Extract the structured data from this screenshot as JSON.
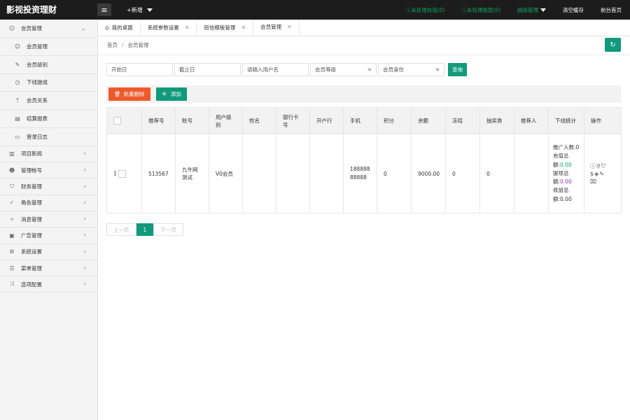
{
  "app": {
    "title": "影视投资理财",
    "menu_icon": "menu-icon",
    "new_label": "+新增"
  },
  "topbar": {
    "links": [
      {
        "label": "未处理充值(0)",
        "icon": "info-icon",
        "color": "#0aa65a"
      },
      {
        "label": "未处理提款(0)",
        "icon": "info-icon",
        "color": "#0aa65a"
      },
      {
        "label": "超级管理",
        "color": "#0aa65a"
      },
      {
        "label": "清空缓存",
        "color": "#ffffff"
      },
      {
        "label": "前台首页",
        "color": "#ffffff"
      }
    ]
  },
  "sidebar": {
    "group": "会员管理",
    "subitems": [
      "会员管理",
      "会员级别",
      "下线提成",
      "会员关系",
      "结算报表",
      "登录日志"
    ],
    "items": [
      "项目新闻",
      "管理帐号",
      "财务管理",
      "角色管理",
      "消息管理",
      "广告管理",
      "系统设置",
      "菜单管理",
      "选项配置"
    ]
  },
  "tabs": [
    {
      "label": "我的桌面",
      "icon": "home-icon"
    },
    {
      "label": "系统参数设置"
    },
    {
      "label": "短信模板管理"
    },
    {
      "label": "会员管理"
    }
  ],
  "breadcrumb": {
    "home": "首页",
    "sep": "/",
    "current": "会员管理"
  },
  "filters": {
    "start_date": "开始日",
    "end_date": "截止日",
    "username": "请输入用户名",
    "member_level": "会员等级",
    "member_identity": "会员身份",
    "search_label": "查询"
  },
  "toolbar": {
    "batch_delete": "批量删除",
    "add": "添加"
  },
  "table": {
    "headers": [
      "推荐号",
      "账号",
      "用户级别",
      "姓名",
      "银行卡号",
      "开户行",
      "手机",
      "积分",
      "余额",
      "冻结",
      "抽奖券",
      "推荐人",
      "下线统计",
      "操作"
    ],
    "rows": [
      {
        "index": "1",
        "referral_no": "513567",
        "account": "九牛网测试",
        "level": "V0会员",
        "name": "",
        "bank_card": "",
        "bank": "",
        "phone": "18888888888",
        "points": "0",
        "balance": "9000.00",
        "frozen": "0",
        "lottery": "0",
        "referrer": "",
        "stats": {
          "promoters_label": "推广人数:",
          "promoters": "0",
          "recharge_label": "充值总额:",
          "recharge": "0.00",
          "withdraw_label": "提现总额:",
          "withdraw": "0.00",
          "income_label": "收益总额:",
          "income": "0.00"
        }
      }
    ]
  },
  "pagination": {
    "prev": "上一页",
    "current": "1",
    "next": "下一页"
  }
}
